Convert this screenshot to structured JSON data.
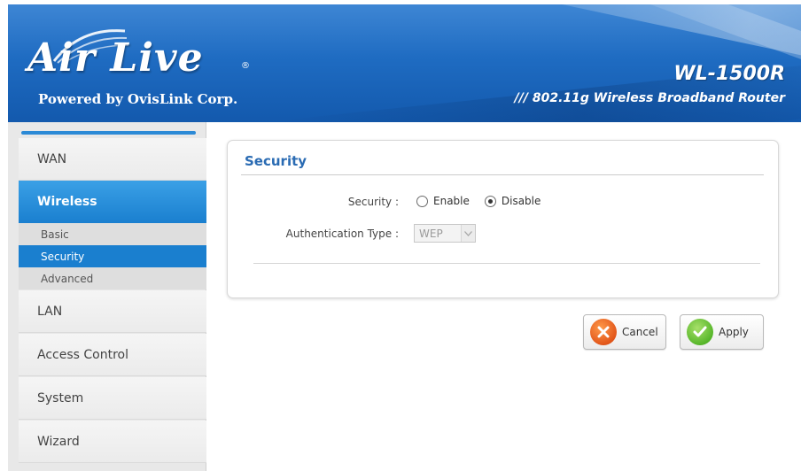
{
  "header": {
    "logo_text": "Air Live",
    "logo_registered": "®",
    "logo_tagline": "Powered by OvisLink Corp.",
    "model": "WL-1500R",
    "model_description": "/// 802.11g Wireless Broadband Router"
  },
  "sidebar": {
    "items": [
      {
        "label": "WAN",
        "active": false
      },
      {
        "label": "Wireless",
        "active": true
      },
      {
        "label": "LAN",
        "active": false
      },
      {
        "label": "Access Control",
        "active": false
      },
      {
        "label": "System",
        "active": false
      },
      {
        "label": "Wizard",
        "active": false
      }
    ],
    "wireless_subitems": [
      {
        "label": "Basic",
        "active": false
      },
      {
        "label": "Security",
        "active": true
      },
      {
        "label": "Advanced",
        "active": false
      }
    ]
  },
  "panel": {
    "title": "Security",
    "security_label": "Security :",
    "security_options": [
      {
        "label": "Enable",
        "selected": false
      },
      {
        "label": "Disable",
        "selected": true
      }
    ],
    "auth_label": "Authentication Type :",
    "auth_value": "WEP"
  },
  "buttons": {
    "cancel": "Cancel",
    "apply": "Apply"
  },
  "colors": {
    "header_blue": "#1f6cc2",
    "active_blue": "#1a7fcf",
    "title_blue": "#2a6bb3",
    "cancel_orange": "#e2561a",
    "apply_green": "#57b62a"
  }
}
